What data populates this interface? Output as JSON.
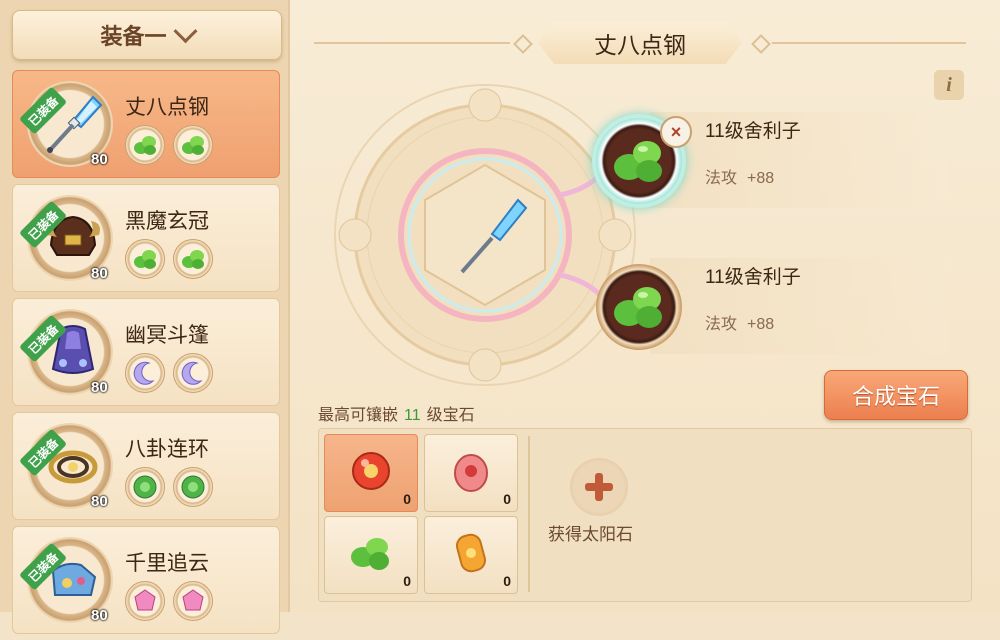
{
  "set_selector": {
    "label": "装备一"
  },
  "equipment": [
    {
      "name": "丈八点钢",
      "level": "80",
      "equipped_badge": "已装备",
      "gem_type": "green",
      "selected": true
    },
    {
      "name": "黑魔玄冠",
      "level": "80",
      "equipped_badge": "已装备",
      "gem_type": "green",
      "selected": false
    },
    {
      "name": "幽冥斗篷",
      "level": "80",
      "equipped_badge": "已装备",
      "gem_type": "moon",
      "selected": false
    },
    {
      "name": "八卦连环",
      "level": "80",
      "equipped_badge": "已装备",
      "gem_type": "jade",
      "selected": false
    },
    {
      "name": "千里追云",
      "level": "80",
      "equipped_badge": "已装备",
      "gem_type": "pink",
      "selected": false
    }
  ],
  "main": {
    "title": "丈八点钢",
    "info_icon": "i",
    "socketed_gems": [
      {
        "name": "11级舍利子",
        "attr": "法攻",
        "value": "+88"
      },
      {
        "name": "11级舍利子",
        "attr": "法攻",
        "value": "+88"
      }
    ],
    "remove_icon": "×",
    "craft_button": "合成宝石",
    "max_label_prefix": "最高可镶嵌",
    "max_level": "11",
    "max_label_suffix": "级宝石"
  },
  "inventory": [
    {
      "gem": "sun-stone-red",
      "count": "0"
    },
    {
      "gem": "red-gem",
      "count": "0"
    },
    {
      "gem": "sarira-green",
      "count": "0"
    },
    {
      "gem": "orange-gem",
      "count": "0"
    }
  ],
  "obtain": {
    "label": "获得太阳石"
  },
  "colors": {
    "accent": "#ec7f4f",
    "green_level": "#3b9b3a",
    "ribbon": "#3fa14a"
  }
}
